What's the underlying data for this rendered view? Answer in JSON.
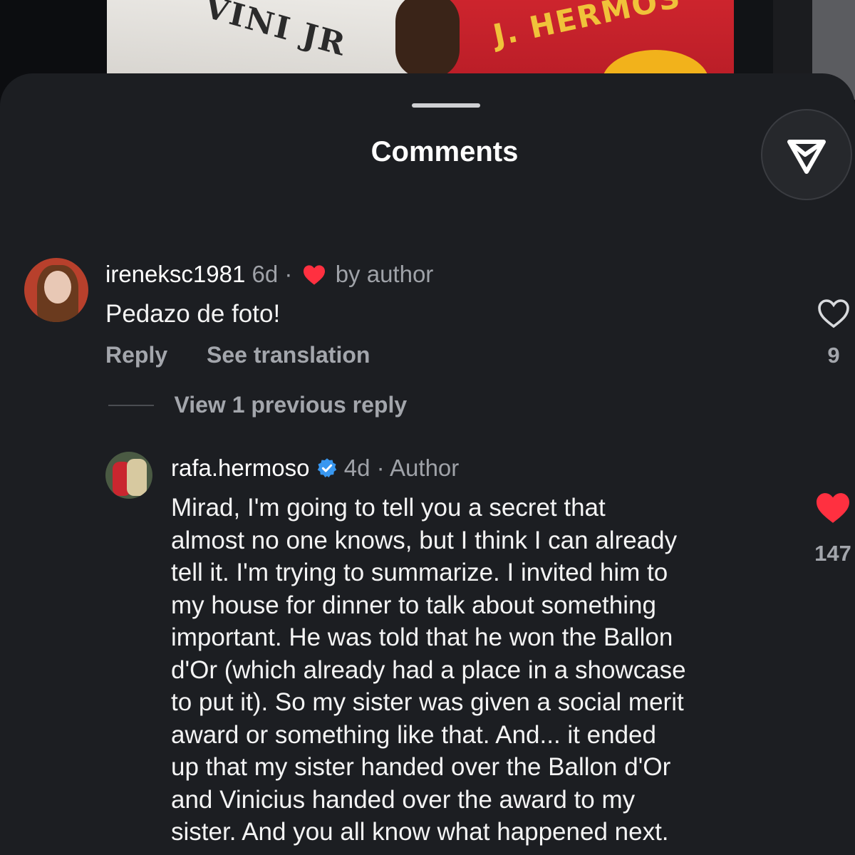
{
  "photo": {
    "left_shirt_text": "VINI JR",
    "right_shirt_text": "J. HERMOS"
  },
  "sheet": {
    "title": "Comments"
  },
  "comments": [
    {
      "username": "ireneksc1981",
      "time": "6d",
      "separator": "·",
      "liked_by_author_label": "by author",
      "text": "Pedazo de foto!",
      "reply_label": "Reply",
      "translate_label": "See translation",
      "like_count": "9",
      "liked": false
    }
  ],
  "view_replies_label": "View 1 previous reply",
  "reply": {
    "username": "rafa.hermoso",
    "verified": true,
    "time": "4d",
    "separator": "·",
    "badge": "Author",
    "lines": [
      "Mirad, I'm going to tell you a secret that",
      "almost no one knows, but I think I can already",
      "tell it. I'm trying to summarize. I invited him to",
      "my house for dinner to talk about something",
      "important. He was told that he won the Ballon",
      "d'Or (which already had a place in a showcase",
      "to put it). So my sister was given a social merit",
      "award or something like that. And... it ended",
      "up that my sister handed over the Ballon d'Or",
      "and Vinicius handed over the award to my",
      "sister. And you all know what happened next."
    ],
    "like_count": "147",
    "liked": true
  },
  "colors": {
    "sheet_bg": "#1c1e22",
    "heart_red": "#ff3040",
    "verified_blue": "#3897f0",
    "muted_text": "#a3a6ac"
  }
}
